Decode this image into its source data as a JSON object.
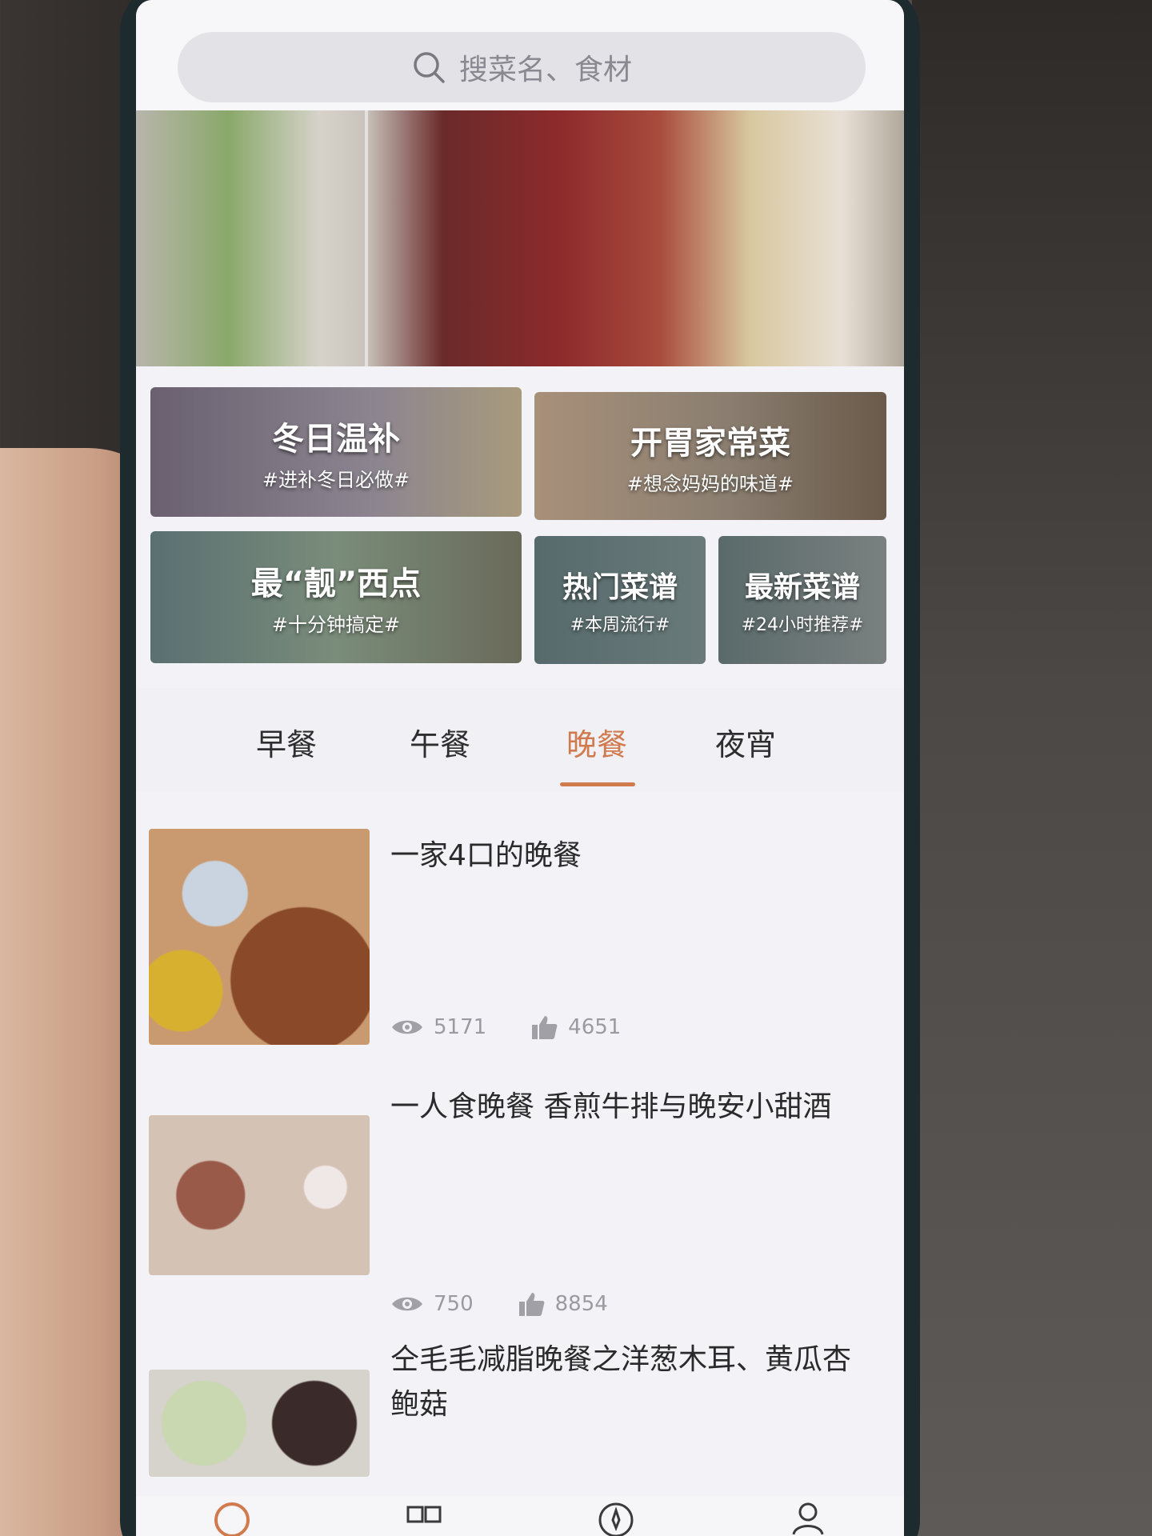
{
  "search": {
    "placeholder": "搜菜名、食材"
  },
  "categories": [
    {
      "title": "冬日温补",
      "tag": "#进补冬日必做#"
    },
    {
      "title": "开胃家常菜",
      "tag": "#想念妈妈的味道#"
    },
    {
      "title": "最“靓”西点",
      "tag": "#十分钟搞定#"
    },
    {
      "title": "热门菜谱",
      "tag": "#本周流行#"
    },
    {
      "title": "最新菜谱",
      "tag": "#24小时推荐#"
    }
  ],
  "tabs": [
    {
      "label": "早餐"
    },
    {
      "label": "午餐"
    },
    {
      "label": "晚餐",
      "active": true
    },
    {
      "label": "夜宵"
    }
  ],
  "recipes": [
    {
      "title": "一家4口的晚餐",
      "views": "5171",
      "likes": "4651"
    },
    {
      "title": "一人食晚餐 香煎牛排与晚安小甜酒",
      "views": "750",
      "likes": "8854"
    },
    {
      "title": "仝毛毛减脂晚餐之洋葱木耳、黄瓜杏鲍菇"
    }
  ],
  "colors": {
    "accent": "#d07a4e",
    "text": "#2a2a2c",
    "muted": "#9a9aa0"
  },
  "icons": [
    "search-icon",
    "eye-icon",
    "thumbs-up-icon",
    "home-icon",
    "category-icon",
    "discover-icon",
    "profile-icon"
  ]
}
